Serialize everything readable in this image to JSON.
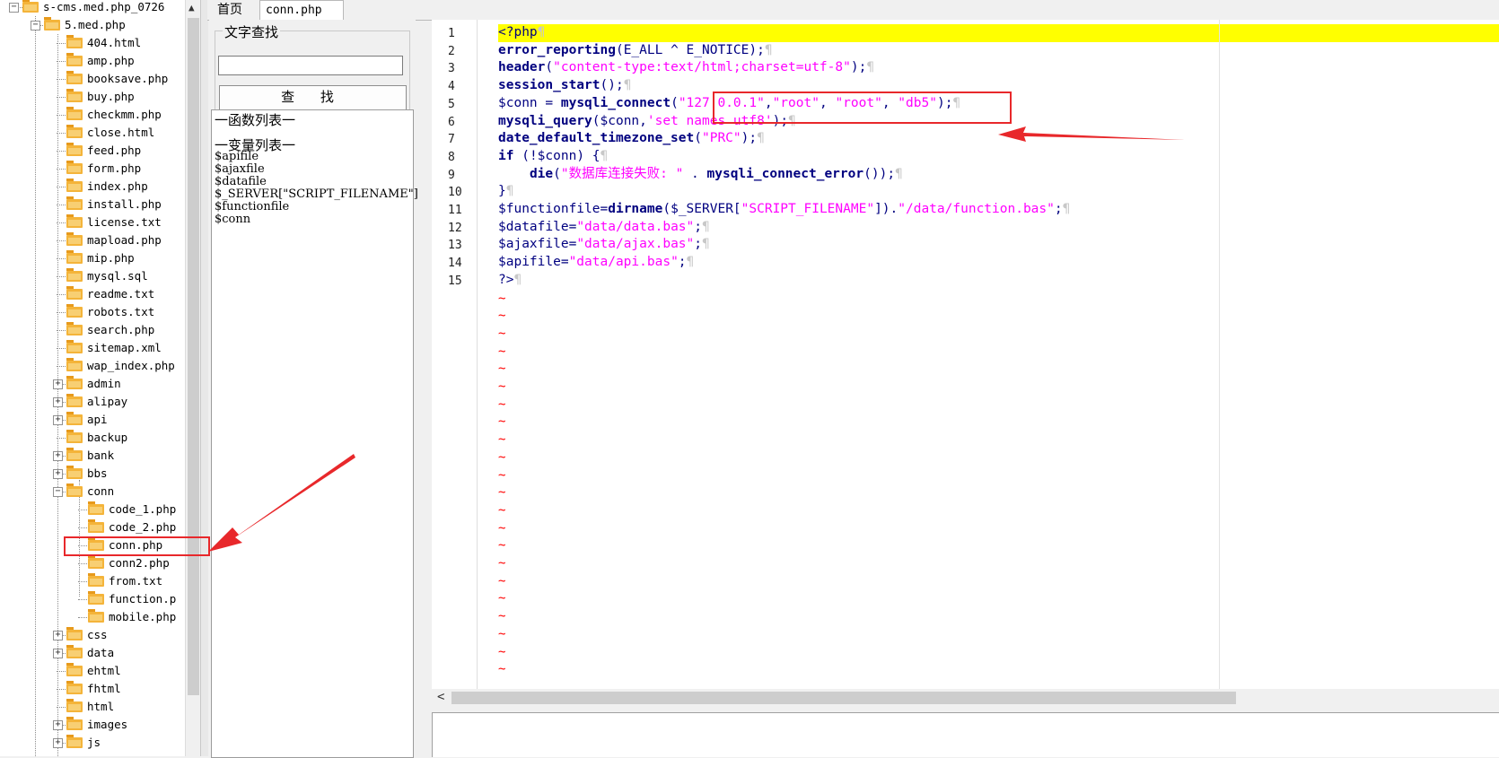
{
  "tree": {
    "root": "s-cms.med.php_0726",
    "subroot": "5.med.php",
    "files": [
      "404.html",
      "amp.php",
      "booksave.php",
      "buy.php",
      "checkmm.php",
      "close.html",
      "feed.php",
      "form.php",
      "index.php",
      "install.php",
      "license.txt",
      "mapload.php",
      "mip.php",
      "mysql.sql",
      "readme.txt",
      "robots.txt",
      "search.php",
      "sitemap.xml",
      "wap_index.php"
    ],
    "folders_a": [
      "admin",
      "alipay",
      "api",
      "backup",
      "bank",
      "bbs",
      "conn"
    ],
    "conn_children": [
      "code_1.php",
      "code_2.php",
      "conn.php",
      "conn2.php",
      "from.txt",
      "function.p",
      "mobile.php"
    ],
    "folders_b": [
      "css",
      "data",
      "ehtml",
      "fhtml",
      "html",
      "images",
      "js"
    ],
    "selected": "conn.php"
  },
  "tabs": {
    "home": "首页",
    "file": "conn.php"
  },
  "search": {
    "title": "文字查找",
    "button": "查 找",
    "value": ""
  },
  "lists": {
    "functions_heading": "一函数列表一",
    "variables_heading": "一变量列表一",
    "variables": [
      "$apifile",
      "$ajaxfile",
      "$datafile",
      "$_SERVER[\"SCRIPT_FILENAME\"]",
      "$functionfile",
      "$conn"
    ]
  },
  "editor": {
    "line_numbers": [
      "1",
      "2",
      "3",
      "4",
      "5",
      "6",
      "7",
      "8",
      "9",
      "10",
      "11",
      "12",
      "13",
      "14",
      "15"
    ],
    "lines": [
      "<?php",
      "error_reporting(E_ALL ^ E_NOTICE);",
      "header(\"content-type:text/html;charset=utf-8\");",
      "session_start();",
      "$conn = mysqli_connect(\"127.0.0.1\",\"root\", \"root\", \"db5\");",
      "mysqli_query($conn,'set names utf8');",
      "date_default_timezone_set(\"PRC\");",
      "if (!$conn) {",
      "    die(\"数据库连接失败: \" . mysqli_connect_error());",
      "}",
      "$functionfile=dirname($_SERVER[\"SCRIPT_FILENAME\"]).\"/data/function.bas\";",
      "$datafile=\"data/data.bas\";",
      "$ajaxfile=\"data/ajax.bas\";",
      "$apifile=\"data/api.bas\";",
      "?>"
    ],
    "tilde": "~"
  },
  "colors": {
    "highlight": "#ffff00",
    "annotation": "#e8282b",
    "string": "#ff00ff",
    "keyword": "#00007f"
  }
}
